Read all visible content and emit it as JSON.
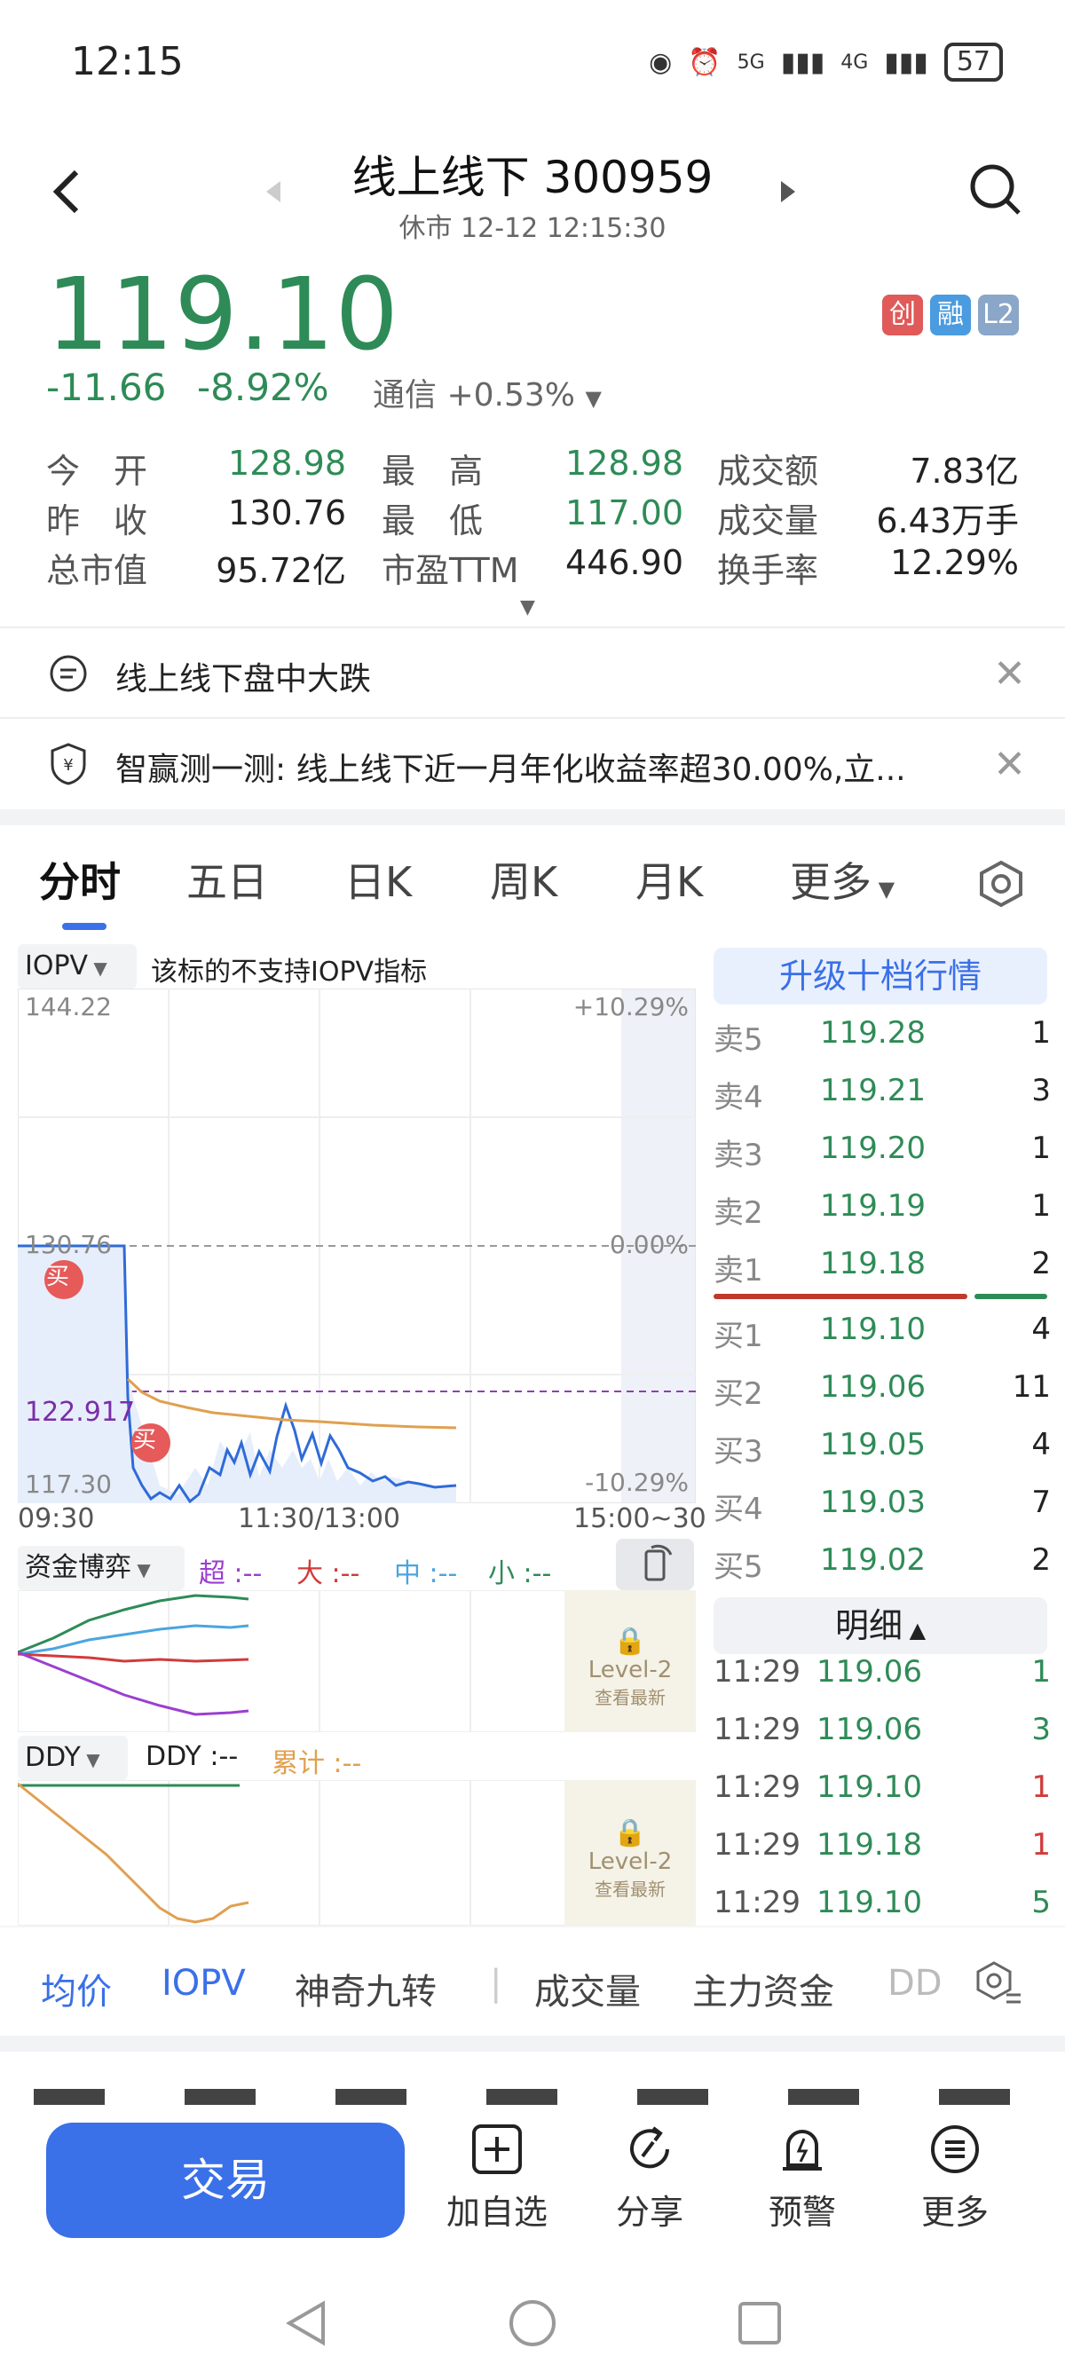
{
  "status": {
    "time": "12:15",
    "net1": "5G",
    "net2": "4G",
    "battery": "57"
  },
  "header": {
    "title": "线上线下 300959",
    "subtitle": "休市 12-12 12:15:30"
  },
  "quote": {
    "price": "119.10",
    "change": "-11.66",
    "change_pct": "-8.92%",
    "sector": "通信",
    "sector_change": "+0.53%",
    "badges": [
      {
        "text": "创",
        "color": "#e05a5a"
      },
      {
        "text": "融",
        "color": "#4a9be0"
      },
      {
        "text": "L2",
        "color": "#8aa6c8"
      }
    ]
  },
  "stats": [
    {
      "label": "今　开",
      "value": "128.98",
      "color": "green"
    },
    {
      "label": "最　高",
      "value": "128.98",
      "color": "green"
    },
    {
      "label": "成交额",
      "value": "7.83亿",
      "color": "dark"
    },
    {
      "label": "昨　收",
      "value": "130.76",
      "color": "dark"
    },
    {
      "label": "最　低",
      "value": "117.00",
      "color": "green"
    },
    {
      "label": "成交量",
      "value": "6.43万手",
      "color": "dark"
    },
    {
      "label": "总市值",
      "value": "95.72亿",
      "color": "dark"
    },
    {
      "label": "市盈TTM",
      "value": "446.90",
      "color": "dark"
    },
    {
      "label": "换手率",
      "value": "12.29%",
      "color": "dark"
    }
  ],
  "notices": [
    {
      "text": "线上线下盘中大跌"
    },
    {
      "text": "智赢测一测: 线上线下近一月年化收益率超30.00%,立..."
    }
  ],
  "tabs": [
    "分时",
    "五日",
    "日K",
    "周K",
    "月K",
    "更多"
  ],
  "chart": {
    "iopv_label": "IOPV",
    "iopv_note": "该标的不支持IOPV指标",
    "y_top": "144.22",
    "y_mid": "130.76",
    "y_avg": "122.917",
    "y_bot": "117.30",
    "pct_top": "+10.29%",
    "pct_mid": "0.00%",
    "pct_bot": "-10.29%",
    "x_start": "09:30",
    "x_mid": "11:30/13:00",
    "x_end": "15:00~30",
    "buy_mark": "买"
  },
  "funds": {
    "label": "资金博弈",
    "super": "超 :--",
    "big": "大 :--",
    "mid": "中 :--",
    "small": "小 :--",
    "lock": "Level-2",
    "lock_sub": "查看最新"
  },
  "ddy": {
    "label": "DDY",
    "value": "DDY :--",
    "cum": "累计 :--",
    "lock": "Level-2",
    "lock_sub": "查看最新"
  },
  "orderbook": {
    "upgrade": "升级十档行情",
    "sells": [
      {
        "label": "卖5",
        "price": "119.28",
        "vol": "1"
      },
      {
        "label": "卖4",
        "price": "119.21",
        "vol": "3"
      },
      {
        "label": "卖3",
        "price": "119.20",
        "vol": "1"
      },
      {
        "label": "卖2",
        "price": "119.19",
        "vol": "1"
      },
      {
        "label": "卖1",
        "price": "119.18",
        "vol": "2"
      }
    ],
    "buys": [
      {
        "label": "买1",
        "price": "119.10",
        "vol": "4"
      },
      {
        "label": "买2",
        "price": "119.06",
        "vol": "11"
      },
      {
        "label": "买3",
        "price": "119.05",
        "vol": "4"
      },
      {
        "label": "买4",
        "price": "119.03",
        "vol": "7"
      },
      {
        "label": "买5",
        "price": "119.02",
        "vol": "2"
      }
    ],
    "detail": "明细",
    "details": [
      {
        "time": "11:29",
        "price": "119.06",
        "vol": "1",
        "color": "#2e8b57"
      },
      {
        "time": "11:29",
        "price": "119.06",
        "vol": "3",
        "color": "#2e8b57"
      },
      {
        "time": "11:29",
        "price": "119.10",
        "vol": "1",
        "color": "#d23b3b"
      },
      {
        "time": "11:29",
        "price": "119.18",
        "vol": "1",
        "color": "#d23b3b"
      },
      {
        "time": "11:29",
        "price": "119.10",
        "vol": "5",
        "color": "#2e8b57"
      }
    ]
  },
  "ind_tabs": [
    "均价",
    "IOPV",
    "神奇九转",
    "成交量",
    "主力资金",
    "DD"
  ],
  "bottom": {
    "trade": "交易",
    "items": [
      "加自选",
      "分享",
      "预警",
      "更多"
    ]
  }
}
